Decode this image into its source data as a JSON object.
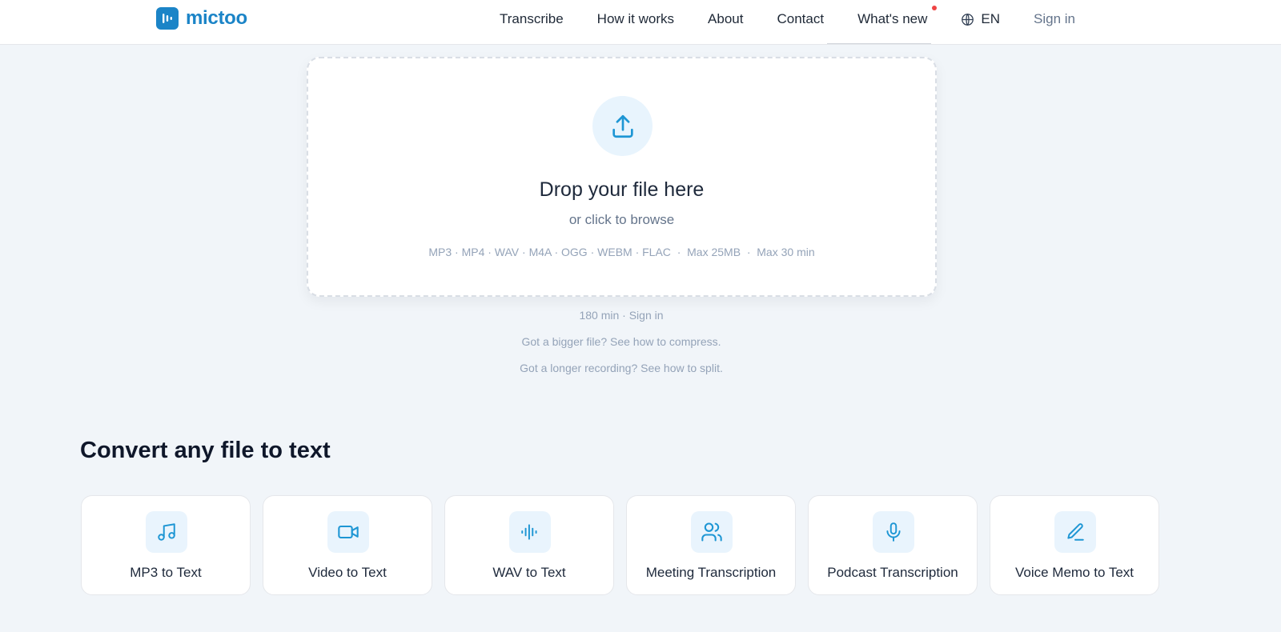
{
  "brand": {
    "name": "mictoo",
    "accent": "#1b84c7",
    "icon": "audio-wave-logo"
  },
  "nav": {
    "items": [
      "Transcribe",
      "How it works",
      "About",
      "Contact",
      "What's new"
    ],
    "lang": "EN",
    "signin": "Sign in",
    "notification_dot_color": "#ef4444"
  },
  "dropzone": {
    "title": "Drop your file here",
    "subtitle": "or click to browse",
    "formats": "MP3 · MP4 · WAV · M4A · OGG · WEBM · FLAC  ·  Max 25MB  ·  Max 30 min",
    "icon": "upload-icon"
  },
  "info": {
    "signin_limit": "180 min · Sign in",
    "compress": "Got a bigger file? See how to compress.",
    "split": "Got a longer recording? See how to split."
  },
  "section": {
    "title": "Convert any file to text",
    "cards": [
      {
        "label": "MP3 to Text",
        "icon": "music-note-icon"
      },
      {
        "label": "Video to Text",
        "icon": "video-camera-icon"
      },
      {
        "label": "WAV to Text",
        "icon": "audio-wave-icon"
      },
      {
        "label": "Meeting Transcription",
        "icon": "users-icon"
      },
      {
        "label": "Podcast Transcription",
        "icon": "microphone-icon"
      },
      {
        "label": "Voice Memo to Text",
        "icon": "pen-icon"
      }
    ]
  }
}
